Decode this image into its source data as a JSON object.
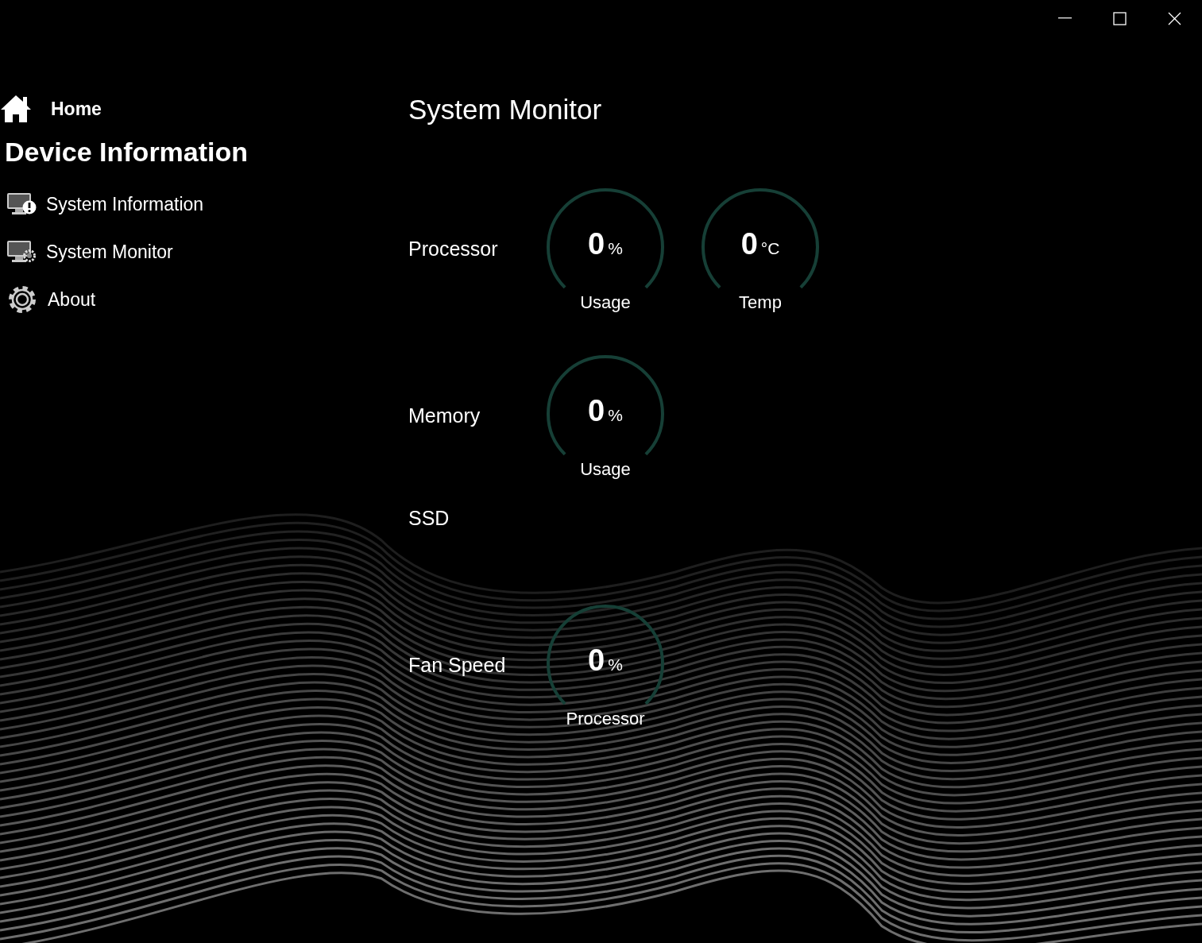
{
  "sidebar": {
    "home": {
      "label": "Home"
    },
    "heading": "Device Information",
    "items": [
      {
        "label": "System Information",
        "kind": "info",
        "selected": false
      },
      {
        "label": "System Monitor",
        "kind": "monitor",
        "selected": false
      },
      {
        "label": "About",
        "kind": "gear",
        "selected": false
      }
    ]
  },
  "page": {
    "title": "System Monitor",
    "sections": [
      {
        "label": "Processor",
        "gauges": [
          {
            "value": "0",
            "unit": "%",
            "caption": "Usage"
          },
          {
            "value": "0",
            "unit": "°C",
            "caption": "Temp"
          }
        ]
      },
      {
        "label": "Memory",
        "gauges": [
          {
            "value": "0",
            "unit": "%",
            "caption": "Usage"
          }
        ]
      },
      {
        "label": "SSD"
      },
      {
        "label": "Fan Speed",
        "gauges": [
          {
            "value": "0",
            "unit": "%",
            "caption": "Processor"
          }
        ]
      }
    ]
  }
}
